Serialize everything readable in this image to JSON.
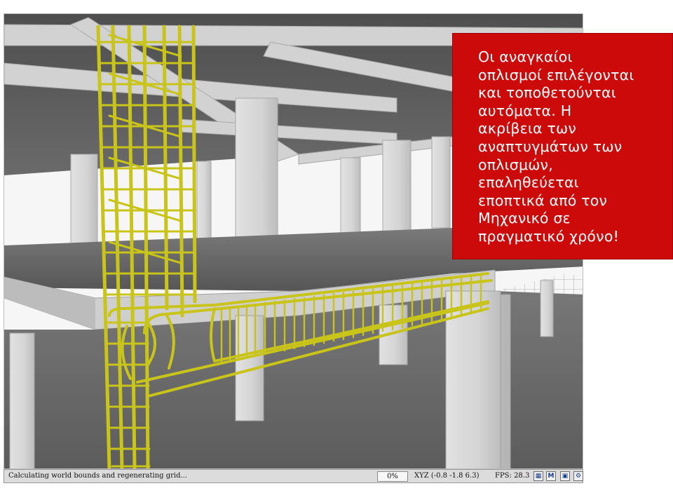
{
  "callout": {
    "lines": [
      "Οι αναγκαίοι",
      "οπλισμοί επιλέγονται",
      "και τοποθετούνται",
      "αυτόματα. Η",
      "ακρίβεια των",
      "αναπτυγμάτων των",
      "οπλισμών,",
      "επαληθεύεται",
      "εποπτικά από τον",
      "Μηχανικό σε",
      "πραγματικό χρόνο!"
    ],
    "background": "#cc0a0a",
    "text_color": "#ffffff"
  },
  "statusbar": {
    "message": "Calculating world bounds and regenerating grid...",
    "progress": "0%",
    "coords": "XYZ (-0.8 -1.8 6.3)",
    "fps": "FPS: 28.3",
    "buttons": [
      {
        "icon": "render-mode-icon",
        "glyph": "▦"
      },
      {
        "icon": "material-icon",
        "glyph": "M"
      },
      {
        "icon": "snapshot-icon",
        "glyph": "▣"
      },
      {
        "icon": "settings-icon",
        "glyph": "⚙"
      }
    ]
  },
  "scene": {
    "concrete_color": "#d9d9d9",
    "slab_color": "#5f5f5f",
    "rebar_color": "#c9c41a"
  }
}
